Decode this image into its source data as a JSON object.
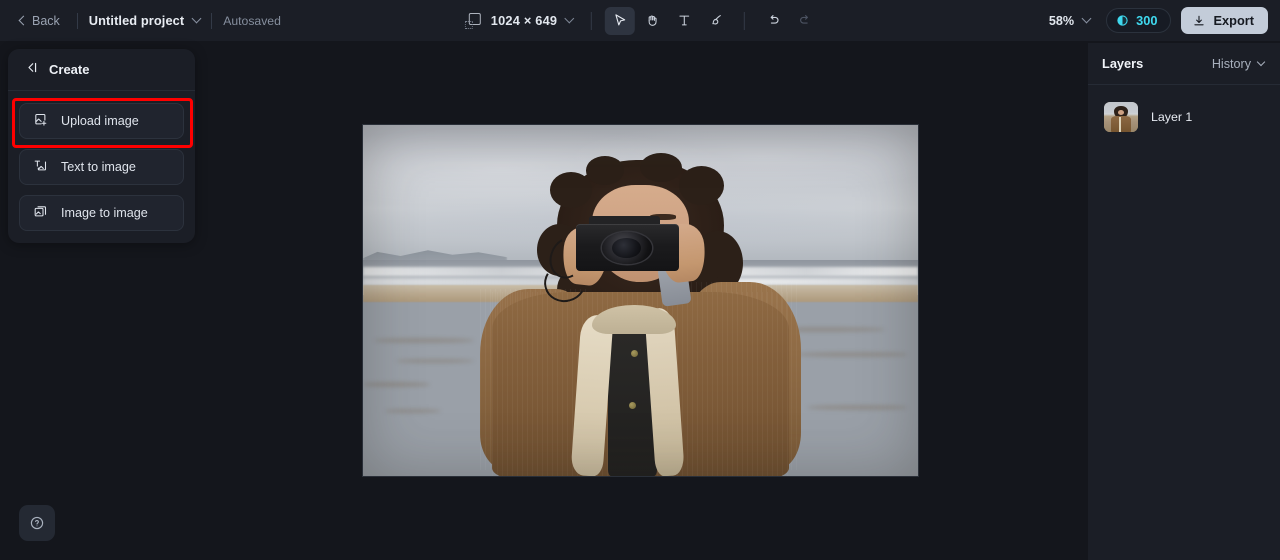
{
  "header": {
    "back_label": "Back",
    "project_title": "Untitled project",
    "autosaved_label": "Autosaved",
    "canvas_size": "1024 × 649",
    "zoom_level": "58%",
    "credits": "300",
    "export_label": "Export",
    "icons": {
      "back_chevron": "chevron-left-icon",
      "project_chevron": "chevron-down-icon",
      "canvas_size_icon": "canvas-resize-icon",
      "select_tool": "cursor-arrow-icon",
      "hand_tool": "hand-pan-icon",
      "text_tool": "text-tool-icon",
      "brush_tool": "brush-tool-icon",
      "undo": "undo-arrow-icon",
      "redo": "redo-arrow-icon",
      "credits_icon": "credit-coin-icon",
      "export_icon": "download-icon"
    },
    "tools": [
      {
        "name": "select",
        "label": "Select",
        "active": true
      },
      {
        "name": "hand",
        "label": "Hand",
        "active": false
      },
      {
        "name": "text",
        "label": "Text",
        "active": false
      },
      {
        "name": "brush",
        "label": "Brush",
        "active": false
      }
    ]
  },
  "create_panel": {
    "title": "Create",
    "collapse_icon": "collapse-panel-icon",
    "items": [
      {
        "label": "Upload image",
        "icon": "upload-image-icon",
        "highlighted": true
      },
      {
        "label": "Text to image",
        "icon": "text-to-image-icon",
        "highlighted": false
      },
      {
        "label": "Image to image",
        "icon": "image-to-image-icon",
        "highlighted": false
      }
    ]
  },
  "help": {
    "icon": "help-question-icon"
  },
  "layers_panel": {
    "layers_tab": "Layers",
    "history_tab": "History",
    "history_chevron": "chevron-down-icon",
    "layers": [
      {
        "name": "Layer 1",
        "thumbnail": "photo-woman-with-camera-on-beach"
      }
    ]
  },
  "canvas": {
    "image_alt": "woman-with-camera-on-beach",
    "accent_color": "#3fd9ef",
    "highlight_color": "#ff0000",
    "export_bg": "#c3ccd9"
  }
}
